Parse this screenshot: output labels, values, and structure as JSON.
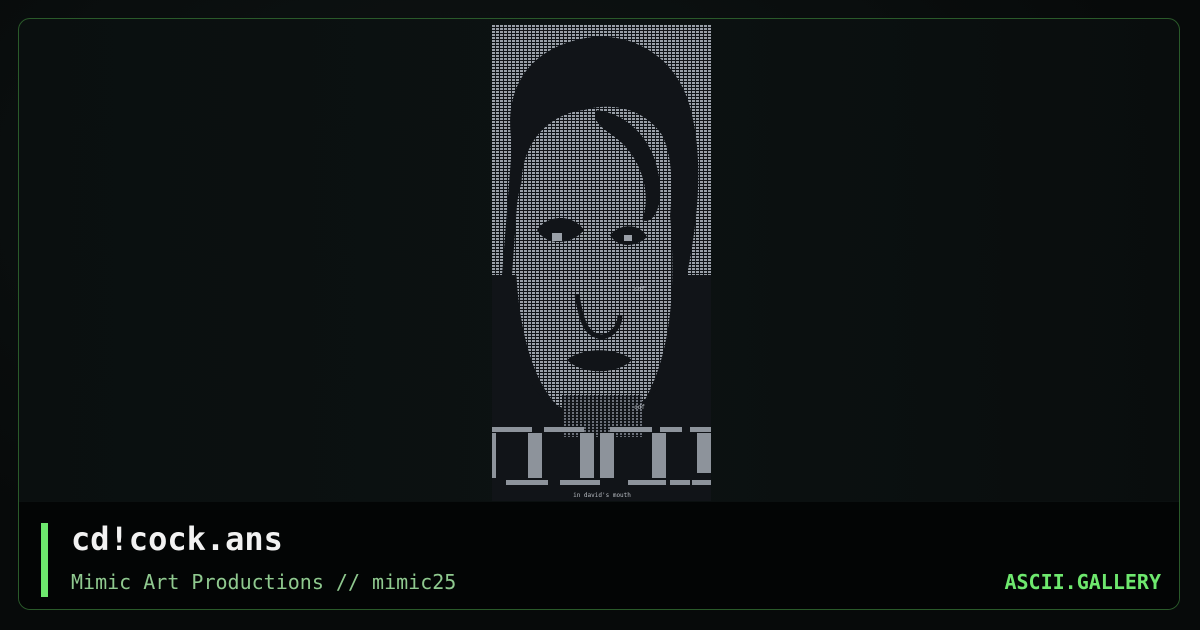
{
  "artwork": {
    "image_description_icon": "ascii-art-face-icon",
    "footer_text": "in david's mouth",
    "tag_text": "cdf",
    "background_color": "#111418",
    "ink_color": "#b8bcc2"
  },
  "caption": {
    "title": "cd!cock.ans",
    "subtitle": "Mimic Art Productions // mimic25",
    "brand": "ASCII.GALLERY"
  },
  "colors": {
    "accent": "#6ee86e",
    "border": "#2a5a2a",
    "subtitle": "#8fc98f"
  }
}
